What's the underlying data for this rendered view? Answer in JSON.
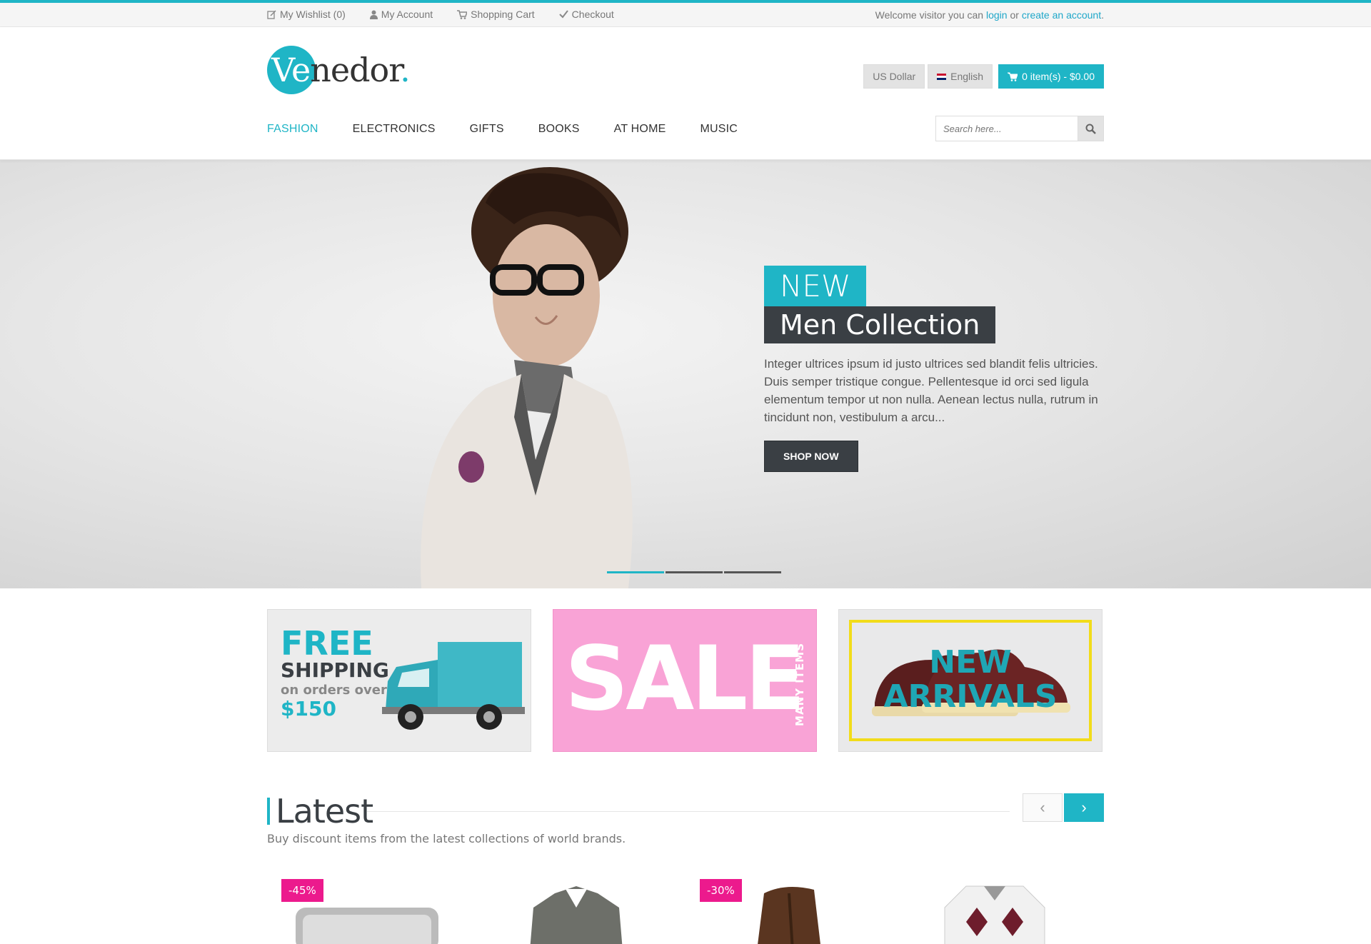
{
  "topbar": {
    "links": [
      {
        "icon": "edit-icon",
        "label": "My Wishlist (0)"
      },
      {
        "icon": "user-icon",
        "label": "My Account"
      },
      {
        "icon": "cart-icon",
        "label": "Shopping Cart"
      },
      {
        "icon": "check-icon",
        "label": "Checkout"
      }
    ],
    "welcome_prefix": "Welcome visitor you can",
    "login_label": "login",
    "or_label": "or",
    "create_label": "create an account",
    "period": "."
  },
  "logo": {
    "part1": "Ve",
    "part2": "nedor",
    "dot": "."
  },
  "header": {
    "currency": "US Dollar",
    "language": "English",
    "cart": "0 item(s) - $0.00"
  },
  "nav": [
    "FASHION",
    "ELECTRONICS",
    "GIFTS",
    "BOOKS",
    "AT HOME",
    "MUSIC"
  ],
  "nav_active": "FASHION",
  "search": {
    "placeholder": "Search here..."
  },
  "hero": {
    "tag1": "NEW",
    "tag2": "Men Collection",
    "text": "Integer ultrices ipsum id justo ultrices sed blandit felis ultricies. Duis semper tristique congue. Pellentesque id orci sed ligula elementum tempor ut non nulla. Aenean lectus nulla, rutrum in tincidunt non, vestibulum a arcu...",
    "button": "SHOP NOW",
    "slides": 3,
    "active_slide": 1
  },
  "banners": {
    "shipping": {
      "free": "FREE",
      "shipping": "SHIPPING",
      "orders": "on orders over",
      "amount": "$150"
    },
    "sale": {
      "sale": "SALE",
      "many": "MANY ITEMS"
    },
    "arrivals": {
      "line1": "NEW",
      "line2": "ARRIVALS"
    }
  },
  "latest": {
    "title": "Latest",
    "subtitle": "Buy discount items from the latest collections of world brands.",
    "prev": "‹",
    "next": "›"
  },
  "products": [
    {
      "badge": "-45%",
      "type": "bracelet"
    },
    {
      "badge": "",
      "type": "jacket"
    },
    {
      "badge": "-30%",
      "type": "boots"
    },
    {
      "badge": "",
      "type": "sweater"
    }
  ],
  "colors": {
    "accent": "#1fb5c6",
    "dark": "#3a3f44",
    "badge": "#ec1a8d",
    "sale_bg": "#f9a3d6"
  }
}
